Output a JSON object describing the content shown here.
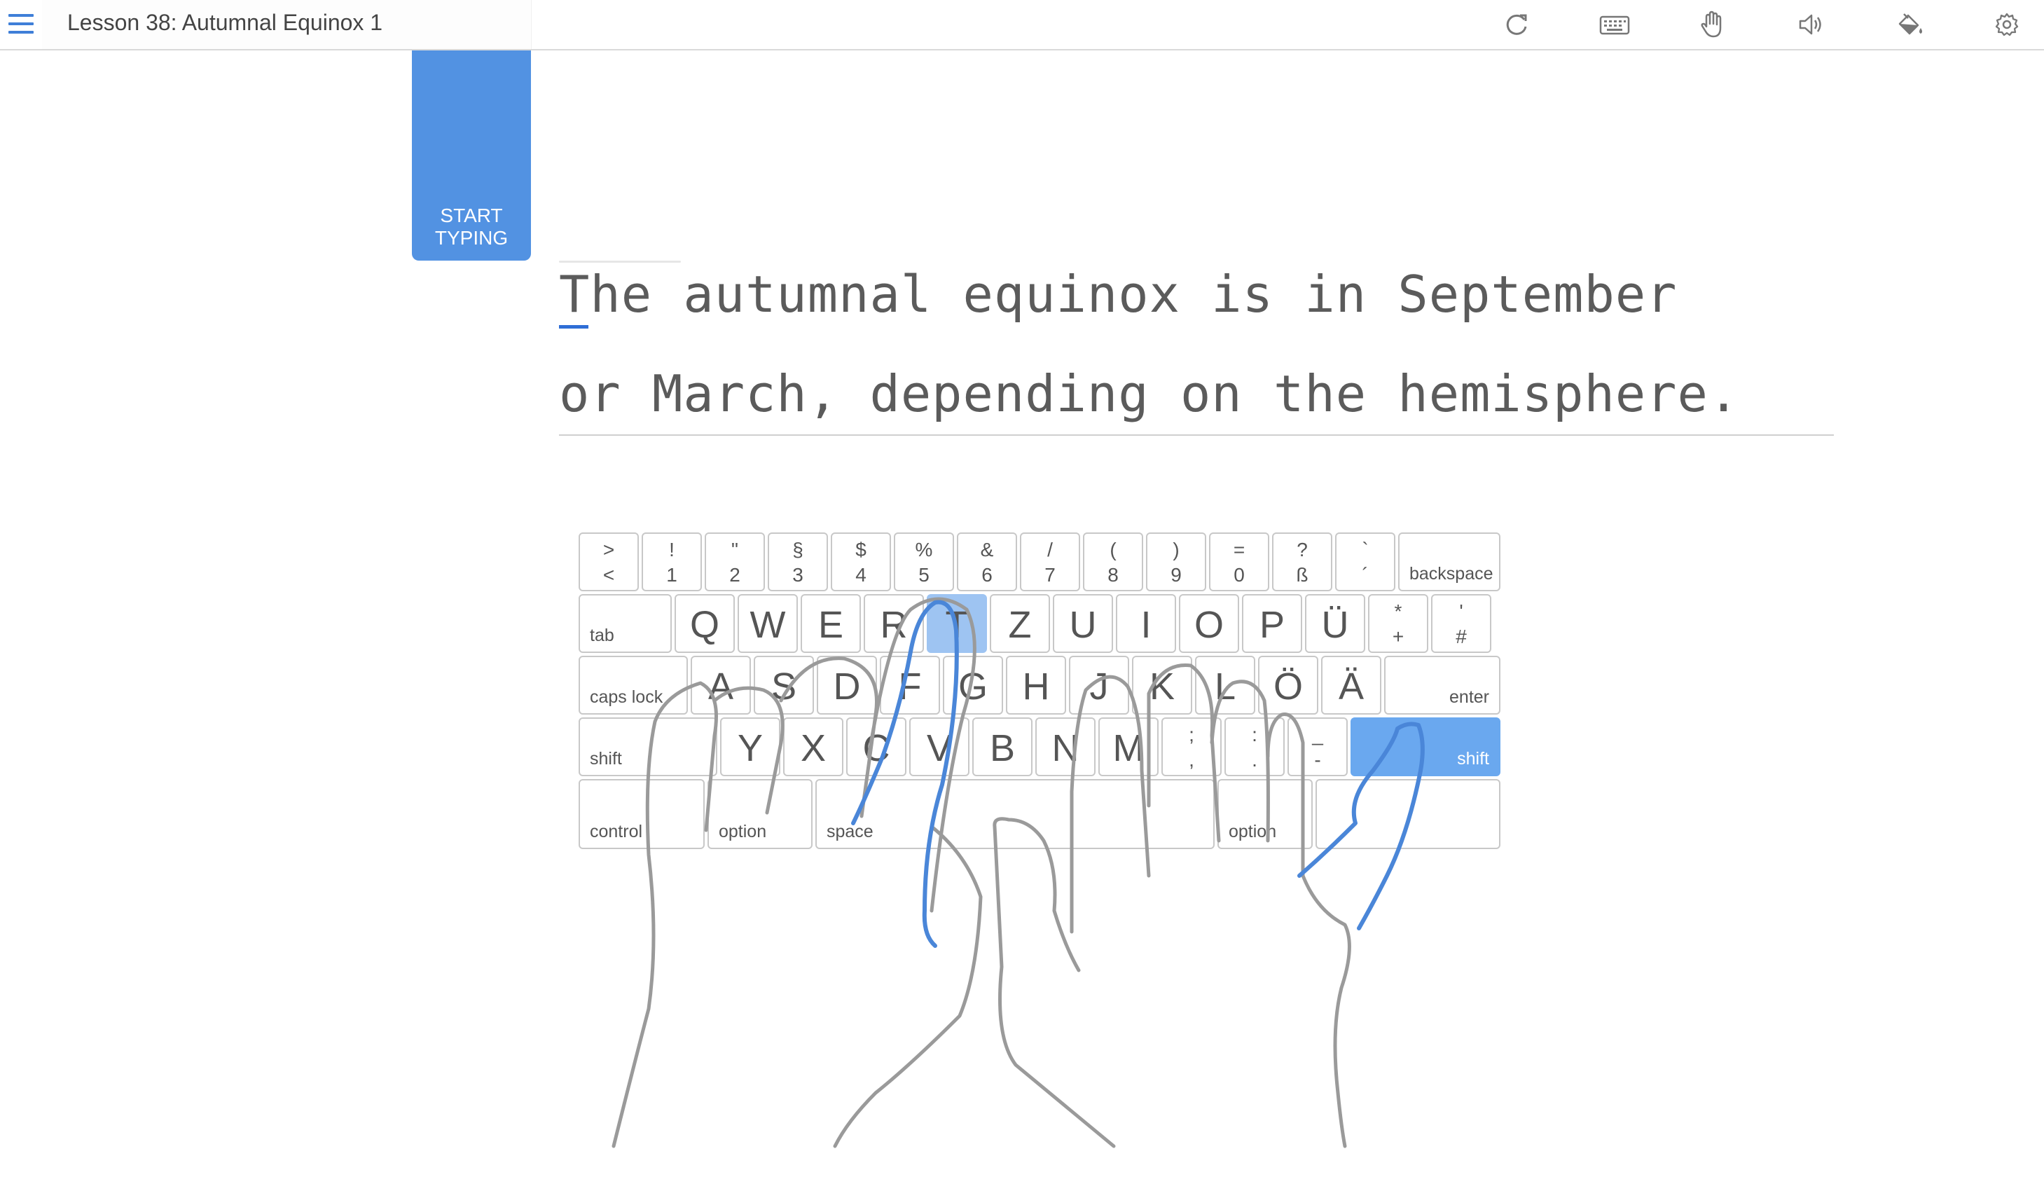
{
  "header": {
    "title": "Lesson 38: Autumnal Equinox 1",
    "icons": [
      "menu-icon",
      "restart-icon",
      "keyboard-icon",
      "hand-icon",
      "sound-icon",
      "paint-bucket-icon",
      "gear-icon"
    ]
  },
  "start_button": {
    "line1": "START",
    "line2": "TYPING"
  },
  "lesson_text": {
    "line1": "The autumnal equinox is in September",
    "line2": "or March, depending on the hemisphere."
  },
  "keyboard": {
    "row1": [
      {
        "top": ">",
        "bottom": "<"
      },
      {
        "top": "!",
        "bottom": "1"
      },
      {
        "top": "\"",
        "bottom": "2"
      },
      {
        "top": "§",
        "bottom": "3"
      },
      {
        "top": "$",
        "bottom": "4"
      },
      {
        "top": "%",
        "bottom": "5"
      },
      {
        "top": "&",
        "bottom": "6"
      },
      {
        "top": "/",
        "bottom": "7"
      },
      {
        "top": "(",
        "bottom": "8"
      },
      {
        "top": ")",
        "bottom": "9"
      },
      {
        "top": "=",
        "bottom": "0"
      },
      {
        "top": "?",
        "bottom": "ß"
      },
      {
        "top": "`",
        "bottom": "´"
      }
    ],
    "backspace": "backspace",
    "tab": "tab",
    "row2": [
      "Q",
      "W",
      "E",
      "R",
      "T",
      "Z",
      "U",
      "I",
      "O",
      "P",
      "Ü"
    ],
    "row2_extra": [
      {
        "top": "*",
        "bottom": "+"
      },
      {
        "top": "'",
        "bottom": "#"
      }
    ],
    "caps": "caps lock",
    "row3": [
      "A",
      "S",
      "D",
      "F",
      "G",
      "H",
      "J",
      "K",
      "L",
      "Ö",
      "Ä"
    ],
    "enter": "enter",
    "shift_left": "shift",
    "row4": [
      "Y",
      "X",
      "C",
      "V",
      "B",
      "N",
      "M"
    ],
    "row4_extra": [
      {
        "top": ";",
        "bottom": ","
      },
      {
        "top": ":",
        "bottom": "."
      },
      {
        "top": "_",
        "bottom": "-"
      }
    ],
    "shift_right": "shift",
    "control": "control",
    "option_left": "option",
    "space": "space",
    "option_right": "option",
    "highlighted_keys": [
      "T",
      "shift_right"
    ],
    "highlight_color": "#6aa8ef"
  },
  "colors": {
    "accent": "#5292e2",
    "finger_highlight": "#4a86d8",
    "hand_outline": "#9a9a9a"
  }
}
